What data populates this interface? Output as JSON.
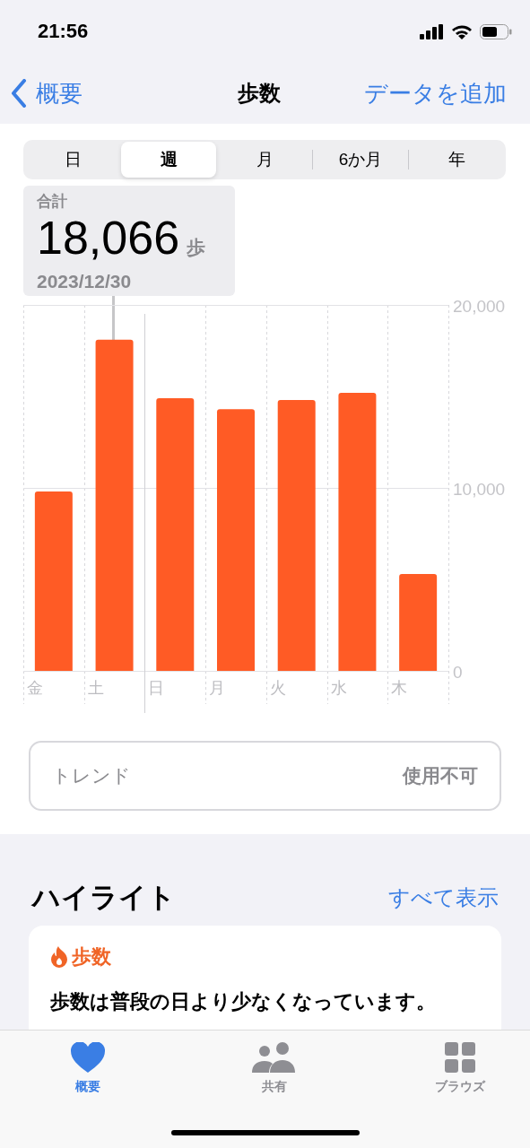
{
  "status_bar": {
    "time": "21:56"
  },
  "nav": {
    "back": "概要",
    "title": "歩数",
    "action": "データを追加"
  },
  "segments": [
    {
      "label": "日",
      "selected": false
    },
    {
      "label": "週",
      "selected": true
    },
    {
      "label": "月",
      "selected": false
    },
    {
      "label": "6か月",
      "selected": false
    },
    {
      "label": "年",
      "selected": false
    }
  ],
  "summary": {
    "label": "合計",
    "value": "18,066",
    "unit": "歩",
    "date": "2023/12/30"
  },
  "chart": {
    "chart_data": {
      "type": "bar",
      "categories": [
        "金",
        "土",
        "日",
        "月",
        "火",
        "水",
        "木"
      ],
      "values": [
        9800,
        18100,
        14900,
        14300,
        14800,
        15200,
        5300
      ],
      "ylim": [
        0,
        20000
      ],
      "yticks": [
        {
          "value": 0,
          "label": "0"
        },
        {
          "value": 10000,
          "label": "10,000"
        },
        {
          "value": 20000,
          "label": "20,000"
        }
      ]
    }
  },
  "trend": {
    "label": "トレンド",
    "value": "使用不可"
  },
  "highlights": {
    "title": "ハイライト",
    "link": "すべて表示",
    "cards": [
      {
        "category": "歩数",
        "text": "歩数は普段の日より少なくなっています。"
      }
    ]
  },
  "tab_bar": [
    {
      "kind": "heart",
      "label": "概要",
      "selected": true
    },
    {
      "kind": "people",
      "label": "共有",
      "selected": false
    },
    {
      "kind": "grid",
      "label": "ブラウズ",
      "selected": false
    }
  ]
}
